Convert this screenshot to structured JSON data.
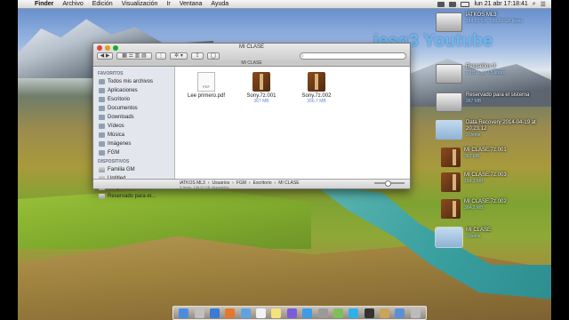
{
  "menubar": {
    "apple": "",
    "app_name": "Finder",
    "menus": [
      "Archivo",
      "Edición",
      "Visualización",
      "Ir",
      "Ventana",
      "Ayuda"
    ],
    "clock": "lun 21 abr  17:18:41"
  },
  "watermark": "iesg3 Youtube",
  "window": {
    "title": "MI CLASE",
    "path_tab": "MI CLASE",
    "search_placeholder": "",
    "toolbar": {
      "back": "◀",
      "forward": "▶",
      "arrange": "⋮",
      "action": "✲ ▾",
      "share": "⇪"
    },
    "sidebar": {
      "favorites_header": "FAVORITOS",
      "favorites": [
        "Todos mis archivos",
        "Aplicaciones",
        "Escritorio",
        "Documentos",
        "Downloads",
        "Vídeos",
        "Música",
        "Imágenes",
        "FGM"
      ],
      "devices_header": "DISPOSITIVOS",
      "devices": [
        "Familia GM",
        "Untitled",
        "Respaldos 3",
        "Reservado para el..."
      ]
    },
    "files": [
      {
        "name": "Lee primero.pdf",
        "size": "",
        "kind": "pdf",
        "badge": "PDF"
      },
      {
        "name": "Sony.7z.001",
        "size": "367 MB",
        "kind": "rar"
      },
      {
        "name": "Sony.7z.002",
        "size": "356,7 MB",
        "kind": "rar"
      }
    ],
    "breadcrumbs": [
      "iATKOS ML3",
      "Usuarios",
      "FGM",
      "Escritorio",
      "MI CLASE"
    ],
    "status": "3 ítems, 138,29 GB disponibles"
  },
  "desktop_items": [
    {
      "name": "iATKOS ML3",
      "sub": "184,61 GB, 138,29 GB libres",
      "kind": "drive"
    },
    {
      "name": "Respaldos 3",
      "sub": "2 TB, 1,17 TB libres",
      "kind": "drive"
    },
    {
      "name": "Reservado para el sistema",
      "sub": "367 MB",
      "kind": "drive"
    },
    {
      "name": "Data Recovery 2014-04-19 at 20.23.12",
      "sub": "3 ítems",
      "kind": "folder"
    },
    {
      "name": "MI CLASE.7z.001",
      "sub": "367 MB",
      "kind": "rar"
    },
    {
      "name": "MI CLASE.7z.003",
      "sub": "154,1 MB",
      "kind": "rar"
    },
    {
      "name": "MI CLASE.7z.002",
      "sub": "364,2 MB",
      "kind": "rar"
    },
    {
      "name": "MI CLASE",
      "sub": "3 ítems",
      "kind": "folder"
    }
  ],
  "dock": {
    "icons": [
      "finder",
      "launchpad",
      "safari",
      "firefox",
      "mail",
      "calendar",
      "notes",
      "itunes",
      "appstore",
      "preferences",
      "photos",
      "skype",
      "terminal",
      "utility",
      "downloads",
      "trash"
    ],
    "colors": [
      "#4a8de0",
      "#c0c0c0",
      "#3a7bd5",
      "#e4782d",
      "#5ea3e0",
      "#f2f2f2",
      "#f5e27a",
      "#7c5bd6",
      "#3f9be8",
      "#9a9a9a",
      "#7fbf5a",
      "#2fb0e8",
      "#333333",
      "#c9a45a",
      "#5b8fd6",
      "#bbbbbb"
    ]
  }
}
